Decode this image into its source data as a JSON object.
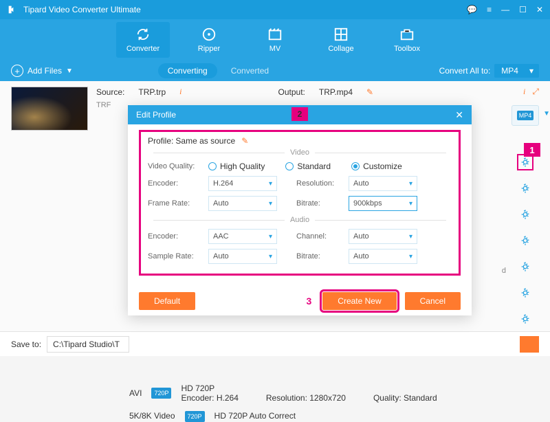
{
  "app": {
    "title": "Tipard Video Converter Ultimate"
  },
  "toolbar": {
    "items": [
      {
        "label": "Converter"
      },
      {
        "label": "Ripper"
      },
      {
        "label": "MV"
      },
      {
        "label": "Collage"
      },
      {
        "label": "Toolbox"
      }
    ]
  },
  "subbar": {
    "add_files": "Add Files",
    "tabs": {
      "converting": "Converting",
      "converted": "Converted"
    },
    "convert_all_label": "Convert All to:",
    "convert_all_value": "MP4"
  },
  "file": {
    "source_label": "Source:",
    "source_value": "TRP.trp",
    "output_label": "Output:",
    "output_value": "TRP.mp4",
    "name_short": "TRF",
    "format_badge": "MP4"
  },
  "modal": {
    "title": "Edit Profile",
    "profile_label": "Profile:",
    "profile_value": "Same as source",
    "section_video": "Video",
    "section_audio": "Audio",
    "video": {
      "quality_label": "Video Quality:",
      "q_high": "High Quality",
      "q_std": "Standard",
      "q_custom": "Customize",
      "encoder_label": "Encoder:",
      "encoder_value": "H.264",
      "framerate_label": "Frame Rate:",
      "framerate_value": "Auto",
      "resolution_label": "Resolution:",
      "resolution_value": "Auto",
      "bitrate_label": "Bitrate:",
      "bitrate_value": "900kbps"
    },
    "audio": {
      "encoder_label": "Encoder:",
      "encoder_value": "AAC",
      "samplerate_label": "Sample Rate:",
      "samplerate_value": "Auto",
      "channel_label": "Channel:",
      "channel_value": "Auto",
      "bitrate_label": "Bitrate:",
      "bitrate_value": "Auto"
    },
    "buttons": {
      "default": "Default",
      "create": "Create New",
      "cancel": "Cancel"
    }
  },
  "callouts": {
    "n1": "1",
    "n2": "2",
    "n3": "3"
  },
  "bg_list": {
    "fmt_avi": "AVI",
    "fmt_5k8k": "5K/8K Video",
    "badge": "720P",
    "title": "HD 720P",
    "enc": "Encoder: H.264",
    "res": "Resolution: 1280x720",
    "qual": "Quality: Standard",
    "title2": "HD 720P Auto Correct"
  },
  "bottom": {
    "save_to_label": "Save to:",
    "save_to_path": "C:\\Tipard Studio\\T"
  },
  "side_text": {
    "d_suffix": "d"
  }
}
